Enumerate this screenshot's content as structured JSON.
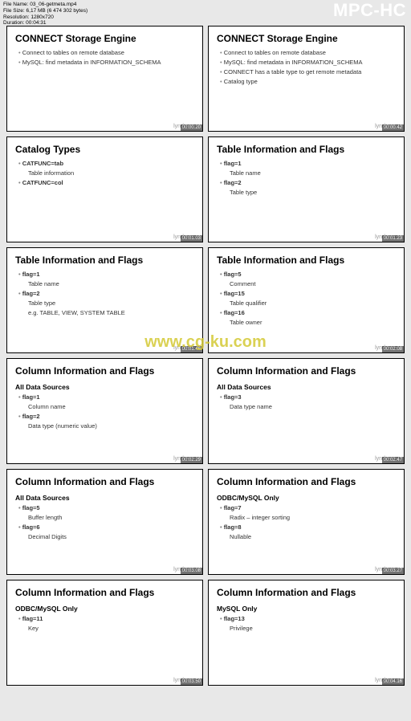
{
  "header": {
    "line1": "File Name: 03_06-getmeta.mp4",
    "line2": "File Size: 6,17 MB (6 474 302 bytes)",
    "line3": "Resolution: 1280x720",
    "line4": "Duration: 00:04:31"
  },
  "watermark": "MPC-HC",
  "center_watermark": "www.cg-ku.com",
  "footer_brand": "lynda.com",
  "slides": [
    {
      "title": "CONNECT Storage Engine",
      "ts": "00:00:20",
      "b1": "Connect to tables on remote database",
      "b2": "MySQL: find metadata in INFORMATION_SCHEMA"
    },
    {
      "title": "CONNECT Storage Engine",
      "ts": "00:00:42",
      "b1": "Connect to tables on remote database",
      "b2": "MySQL: find metadata in INFORMATION_SCHEMA",
      "b3": "CONNECT has a table type to get remote metadata",
      "b4": "Catalog type"
    },
    {
      "title": "Catalog Types",
      "ts": "00:01:03",
      "b1": "CATFUNC=tab",
      "s1": "Table information",
      "b2": "CATFUNC=col"
    },
    {
      "title": "Table Information and Flags",
      "ts": "00:01:23",
      "b1": "flag=1",
      "s1": "Table name",
      "b2": "flag=2",
      "s2": "Table type"
    },
    {
      "title": "Table Information and Flags",
      "ts": "00:01:46",
      "b1": "flag=1",
      "s1": "Table name",
      "b2": "flag=2",
      "s2": "Table type",
      "s3": "e.g. TABLE, VIEW, SYSTEM TABLE"
    },
    {
      "title": "Table Information and Flags",
      "ts": "00:02:08",
      "b1": "flag=5",
      "s1": "Comment",
      "b2": "flag=15",
      "s2": "Table qualifier",
      "b3": "flag=16",
      "s3": "Table owner"
    },
    {
      "title": "Column Information and Flags",
      "ts": "00:02:29",
      "sub": "All Data Sources",
      "b1": "flag=1",
      "s1": "Column name",
      "b2": "flag=2",
      "s2": "Data type (numeric value)"
    },
    {
      "title": "Column Information and Flags",
      "ts": "00:02:47",
      "sub": "All Data Sources",
      "b1": "flag=3",
      "s1": "Data type name"
    },
    {
      "title": "Column Information and Flags",
      "ts": "00:03:08",
      "sub": "All Data Sources",
      "b1": "flag=5",
      "s1": "Buffer length",
      "b2": "flag=6",
      "s2": "Decimal Digits"
    },
    {
      "title": "Column Information and Flags",
      "ts": "00:03:27",
      "sub": "ODBC/MySQL Only",
      "b1": "flag=7",
      "s1": "Radix – integer sorting",
      "b2": "flag=8",
      "s2": "Nullable"
    },
    {
      "title": "Column Information and Flags",
      "ts": "00:03:50",
      "sub": "ODBC/MySQL Only",
      "b1": "flag=11",
      "s1": "Key"
    },
    {
      "title": "Column Information and Flags",
      "ts": "00:04:16",
      "sub": "MySQL Only",
      "b1": "flag=13",
      "s1": "Privilege"
    }
  ]
}
